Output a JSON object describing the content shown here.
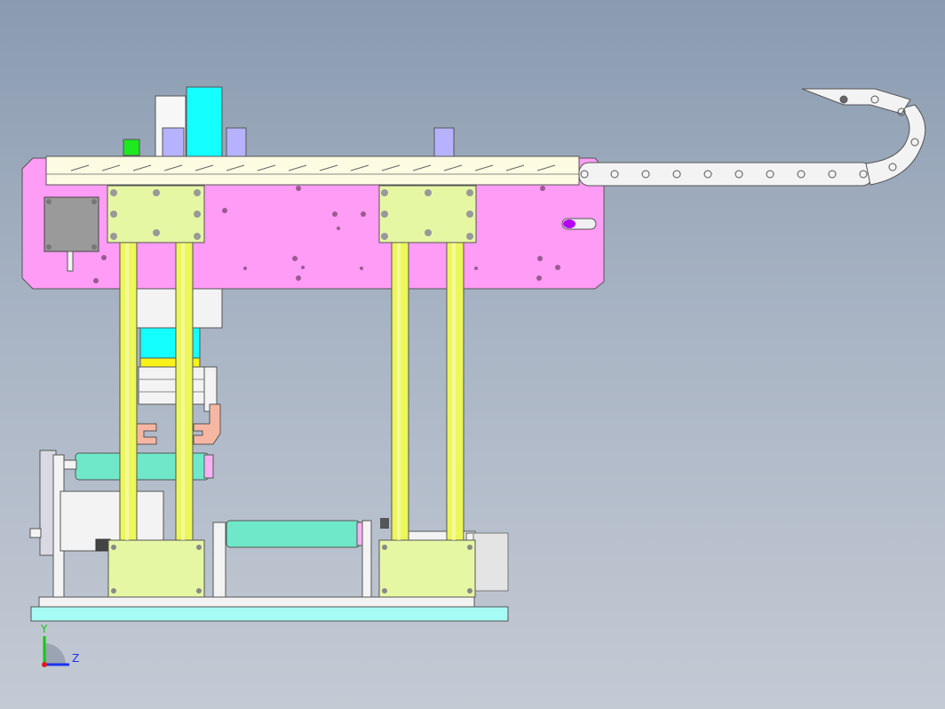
{
  "viewport": {
    "background_top": "#8a9bb0",
    "background_bottom": "#c4cad4"
  },
  "model": {
    "part_colors": {
      "main_plate": "#ff9cf5",
      "bearing_blocks": "#e6f7a4",
      "guide_rods": "#ecf75a",
      "base_plate": "#a6fbf4",
      "cyan_block": "#14ffff",
      "cylinders": "#6ee8c8",
      "drag_chain": "#f3f3f3",
      "gripper": "#f7b6a2",
      "indicator": "#b400f5",
      "green_marker": "#1ee81e",
      "purple_brackets": "#b7b2ff"
    },
    "icons": [
      "stepper-motor-icon",
      "drag-chain-icon",
      "servo-motor-icon",
      "axis-triad-icon"
    ]
  },
  "triad": {
    "y_label": "Y",
    "z_label": "Z",
    "y_color": "#18c418",
    "z_color": "#1a33ee",
    "x_color": "#e01818"
  }
}
